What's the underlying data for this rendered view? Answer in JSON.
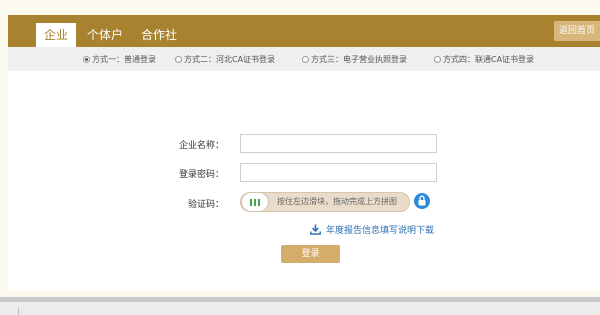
{
  "tabs": [
    {
      "label": "企业",
      "active": true
    },
    {
      "label": "个体户",
      "active": false
    },
    {
      "label": "合作社",
      "active": false
    }
  ],
  "return_home": "返回首页",
  "login_modes": [
    {
      "label": "方式一：普通登录",
      "checked": true
    },
    {
      "label": "方式二：河北CA证书登录",
      "checked": false
    },
    {
      "label": "方式三：电子营业执照登录",
      "checked": false
    },
    {
      "label": "方式四：联通CA证书登录",
      "checked": false
    }
  ],
  "form": {
    "company_name_label": "企业名称：",
    "company_name_value": "",
    "password_label": "登录密码：",
    "password_value": "",
    "captcha_label": "验证码：",
    "slider_hint": "按住左边滑块，拖动完成上方拼图"
  },
  "download_link": "年度报告信息填写说明下载",
  "login_button": "登录",
  "colors": {
    "brand": "#a9822f",
    "button": "#d4ad6b",
    "link": "#2a72b5",
    "lock": "#2e8ad8"
  },
  "icons": {
    "slider_handle": "grip-bars-icon",
    "lock": "lock-icon",
    "download": "download-icon"
  }
}
